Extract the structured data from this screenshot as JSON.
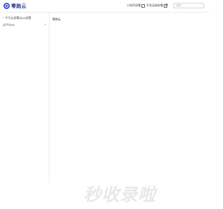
{
  "header": {
    "logo_text": "零跑云",
    "links": [
      {
        "label": "小程序部署"
      },
      {
        "label": "开发运维部署"
      }
    ],
    "search": {
      "placeholder": "搜索",
      "value": ""
    }
  },
  "sidebar": {
    "back_label": "华为云部署云ssl部署",
    "items": [
      {
        "label": "云平台ssl"
      }
    ]
  },
  "main": {
    "title": "零跑云"
  },
  "watermark": "秒收录啦",
  "colors": {
    "brand": "#3a56d4",
    "border": "#ececec"
  }
}
